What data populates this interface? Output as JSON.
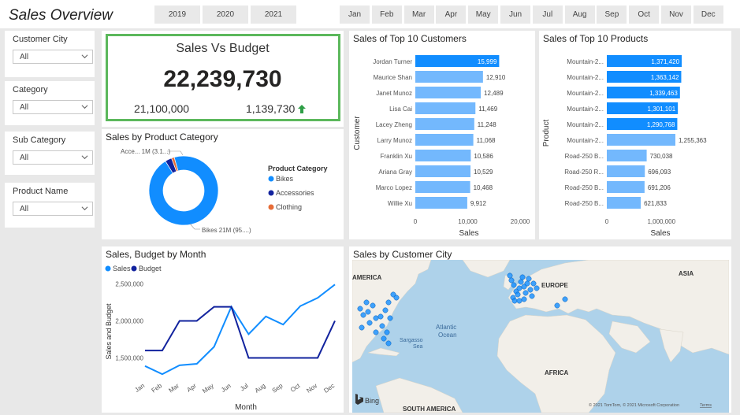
{
  "header": {
    "title": "Sales Overview",
    "years": [
      "2019",
      "2020",
      "2021"
    ],
    "months": [
      "Jan",
      "Feb",
      "Mar",
      "Apr",
      "May",
      "Jun",
      "Jul",
      "Aug",
      "Sep",
      "Oct",
      "Nov",
      "Dec"
    ]
  },
  "filters": [
    {
      "label": "Customer City",
      "value": "All"
    },
    {
      "label": "Category",
      "value": "All"
    },
    {
      "label": "Sub Category",
      "value": "All"
    },
    {
      "label": "Product Name",
      "value": "All"
    }
  ],
  "kpi": {
    "title": "Sales Vs Budget",
    "value": "22,239,730",
    "budget": "21,100,000",
    "variance": "1,139,730",
    "trend_color": "#2e9e46",
    "border_color": "#5cb85c"
  },
  "colors": {
    "primary": "#118dff",
    "light": "#73b8fd",
    "navy": "#12239e",
    "orange": "#e66c37"
  },
  "donut": {
    "title": "Sales by Product Category",
    "legend_title": "Product Category",
    "label_top": "Acce... 1M (3.1...)",
    "label_bottom": "Bikes 21M (95....)",
    "chart_data": {
      "type": "pie",
      "labels": [
        "Bikes",
        "Accessories",
        "Clothing"
      ],
      "values": [
        95.6,
        3.1,
        1.3
      ],
      "colors": [
        "#118dff",
        "#12239e",
        "#e66c37"
      ]
    }
  },
  "customers": {
    "title": "Sales of Top 10 Customers",
    "ylabel": "Customer",
    "xlabel": "Sales",
    "chart_data": {
      "type": "bar",
      "categories": [
        "Jordan Turner",
        "Maurice Shan",
        "Janet Munoz",
        "Lisa Cai",
        "Lacey Zheng",
        "Larry Munoz",
        "Franklin Xu",
        "Ariana Gray",
        "Marco Lopez",
        "Willie Xu"
      ],
      "values": [
        15999,
        12910,
        12489,
        11469,
        11248,
        11068,
        10586,
        10529,
        10468,
        9912
      ],
      "labels": [
        "15,999",
        "12,910",
        "12,489",
        "11,469",
        "11,248",
        "11,068",
        "10,586",
        "10,529",
        "10,468",
        "9,912"
      ],
      "xticks": [
        "0",
        "10,000",
        "20,000"
      ],
      "xlim": [
        0,
        20000
      ],
      "highlight_count": 1
    }
  },
  "products": {
    "title": "Sales of Top 10 Products",
    "ylabel": "Product",
    "xlabel": "Sales",
    "chart_data": {
      "type": "bar",
      "categories": [
        "Mountain-2...",
        "Mountain-2...",
        "Mountain-2...",
        "Mountain-2...",
        "Mountain-2...",
        "Mountain-2...",
        "Road-250 B...",
        "Road-250 R...",
        "Road-250 B...",
        "Road-250 B..."
      ],
      "values": [
        1371420,
        1363142,
        1339463,
        1301101,
        1290768,
        1255363,
        730038,
        696093,
        691206,
        621833
      ],
      "labels": [
        "1,371,420",
        "1,363,142",
        "1,339,463",
        "1,301,101",
        "1,290,768",
        "1,255,363",
        "730,038",
        "696,093",
        "691,206",
        "621,833"
      ],
      "xticks": [
        "0",
        "1,000,000"
      ],
      "xlim": [
        0,
        1400000
      ],
      "highlight_count": 5
    }
  },
  "line": {
    "title": "Sales, Budget by Month",
    "xlabel": "Month",
    "ylabel": "Sales and Budget",
    "yticks": [
      "2,500,000",
      "2,000,000",
      "1,500,000"
    ],
    "chart_data": {
      "type": "line",
      "categories": [
        "Jan",
        "Feb",
        "Mar",
        "Apr",
        "May",
        "Jun",
        "Jul",
        "Aug",
        "Sep",
        "Oct",
        "Nov",
        "Dec"
      ],
      "ylim": [
        1250000,
        2600000
      ],
      "series": [
        {
          "name": "Sales",
          "color": "#118dff",
          "values": [
            1390000,
            1280000,
            1400000,
            1420000,
            1650000,
            2190000,
            1820000,
            2060000,
            1950000,
            2200000,
            2310000,
            2490000
          ]
        },
        {
          "name": "Budget",
          "color": "#12239e",
          "values": [
            1600000,
            1600000,
            2000000,
            2000000,
            2190000,
            2190000,
            1500000,
            1500000,
            1500000,
            1500000,
            1500000,
            2000000
          ]
        }
      ]
    }
  },
  "map": {
    "title": "Sales by Customer City",
    "labels": {
      "america": "AMERICA",
      "europe": "EUROPE",
      "asia": "ASIA",
      "atlantic": "Atlantic",
      "ocean": "Ocean",
      "sargasso": "Sargasso",
      "sea": "Sea",
      "africa": "AFRICA",
      "south_america": "SOUTH AMERICA"
    },
    "bing": "Bing",
    "copyright": "© 2021 TomTom, © 2021 Microsoft Corporation",
    "terms": "Terms"
  }
}
